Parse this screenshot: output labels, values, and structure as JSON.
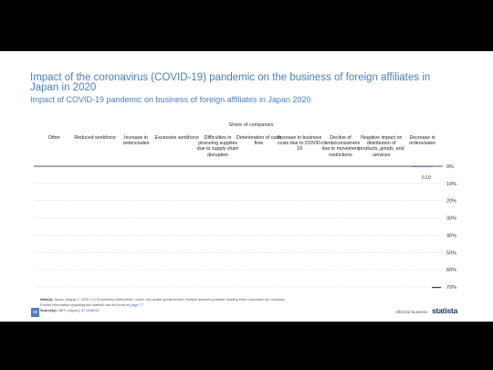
{
  "slide": {
    "title": "Impact of the coronavirus (COVID-19) pandemic on the business of foreign affiliates in Japan in 2020",
    "subtitle": "Impact of COVID-19 pandemic on business of foreign affiliates in Japan 2020",
    "share_label": "Share of companies",
    "page_number": "35",
    "legend_text": "Affected business",
    "brand": "statista"
  },
  "chart_data": {
    "type": "bar",
    "orientation": "vertical-inverted",
    "categories": [
      "Other",
      "Reduced workforce",
      "Increase in orders/sales",
      "Excessive workforce",
      "Difficulties in procuring supplies due to supply chain disruption",
      "Deterioration of cash flow",
      "Increase in business costs due to COVID-19",
      "Decline of clients/consumers due to movement restrictions",
      "Negative impact on distribution of products, goods, and services",
      "Decrease in orders/sales"
    ],
    "series": [
      {
        "values": [
          null,
          null,
          null,
          null,
          null,
          null,
          null,
          null,
          null,
          0.19
        ]
      }
    ],
    "data_labels": [
      "",
      "",
      "",
      "",
      "",
      "",
      "",
      "",
      "",
      "0.19"
    ],
    "y_ticks": [
      "0%",
      "10%",
      "20%",
      "30%",
      "40%",
      "50%",
      "60%",
      "70%"
    ],
    "ylim": [
      0,
      70
    ],
    "grid": true,
    "bar_color": "#1b3e7a"
  },
  "footer": {
    "notes_label": "Note(s):",
    "notes": "Japan; August 1, 2020; 2,476 business enterprises*; online and postal questionnaire; multiple answers possible; leading three responses per company",
    "further_info": "Further information regarding this statistic can be found on",
    "further_link": "page 77",
    "source_label": "Source(s):",
    "source": "METI (Japan);",
    "source_link": "ID 1256932"
  }
}
